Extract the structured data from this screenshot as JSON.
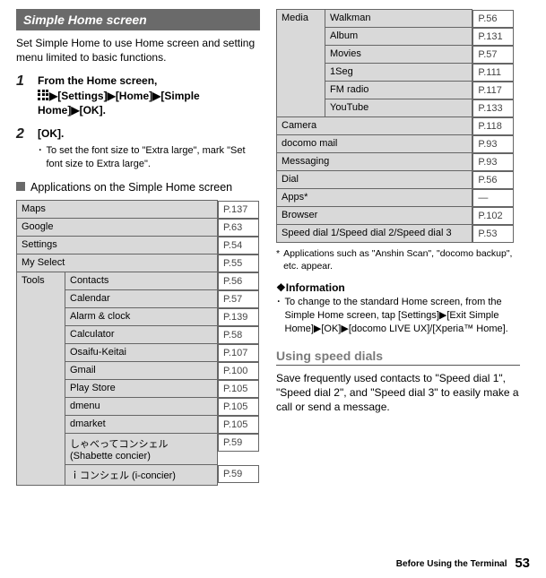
{
  "left": {
    "header": "Simple Home screen",
    "intro": "Set Simple Home to use Home screen and setting menu limited to basic functions.",
    "step1": {
      "num": "1",
      "l1": "From the Home screen, ",
      "l2a": "[Settings]",
      "l2b": "[Home]",
      "l2c": "[Simple Home]",
      "l2d": "[OK]."
    },
    "step2": {
      "num": "2",
      "title": "[OK].",
      "bullet": "To set the font size to \"Extra large\", mark \"Set font size to Extra large\"."
    },
    "subhead": "Applications on the Simple Home screen",
    "rows_top": [
      {
        "name": "Maps",
        "page": "P.137"
      },
      {
        "name": "Google",
        "page": "P.63"
      },
      {
        "name": "Settings",
        "page": "P.54"
      },
      {
        "name": "My Select",
        "page": "P.55"
      }
    ],
    "tools_label": "Tools",
    "tools": [
      {
        "name": "Contacts",
        "page": "P.56"
      },
      {
        "name": "Calendar",
        "page": "P.57"
      },
      {
        "name": "Alarm & clock",
        "page": "P.139"
      },
      {
        "name": "Calculator",
        "page": "P.58"
      },
      {
        "name": "Osaifu-Keitai",
        "page": "P.107"
      },
      {
        "name": "Gmail",
        "page": "P.100"
      },
      {
        "name": "Play Store",
        "page": "P.105"
      },
      {
        "name": "dmenu",
        "page": "P.105"
      },
      {
        "name": "dmarket",
        "page": "P.105"
      },
      {
        "name": "しゃべってコンシェル (Shabette concier)",
        "page": "P.59"
      },
      {
        "name": "ｉコンシェル (i-concier)",
        "page": "P.59"
      }
    ]
  },
  "right": {
    "media_label": "Media",
    "media": [
      {
        "name": "Walkman",
        "page": "P.56"
      },
      {
        "name": "Album",
        "page": "P.131"
      },
      {
        "name": "Movies",
        "page": "P.57"
      },
      {
        "name": "1Seg",
        "page": "P.111"
      },
      {
        "name": "FM radio",
        "page": "P.117"
      },
      {
        "name": "YouTube",
        "page": "P.133"
      }
    ],
    "rows_bottom": [
      {
        "name": "Camera",
        "page": "P.118"
      },
      {
        "name": "docomo mail",
        "page": "P.93"
      },
      {
        "name": "Messaging",
        "page": "P.93"
      },
      {
        "name": "Dial",
        "page": "P.56"
      },
      {
        "name": "Apps*",
        "page": "—"
      },
      {
        "name": "Browser",
        "page": "P.102"
      },
      {
        "name": "Speed dial 1/Speed dial 2/Speed dial 3",
        "page": "P.53"
      }
    ],
    "footnote_mark": "*",
    "footnote": "Applications such as \"Anshin Scan\", \"docomo backup\", etc. appear.",
    "info_head": "❖Information",
    "info_bullet": "To change to the standard Home screen, from the Simple Home screen, tap [Settings]▶[Exit Simple Home]▶[OK]▶[docomo LIVE UX]/[Xperia™ Home].",
    "subsection": "Using speed dials",
    "sub_para": "Save frequently used contacts to \"Speed dial 1\", \"Speed dial 2\", and \"Speed dial 3\" to easily make a call or send a message."
  },
  "footer": {
    "label": "Before Using the Terminal",
    "page": "53"
  },
  "tri": "▶",
  "dot": "･"
}
